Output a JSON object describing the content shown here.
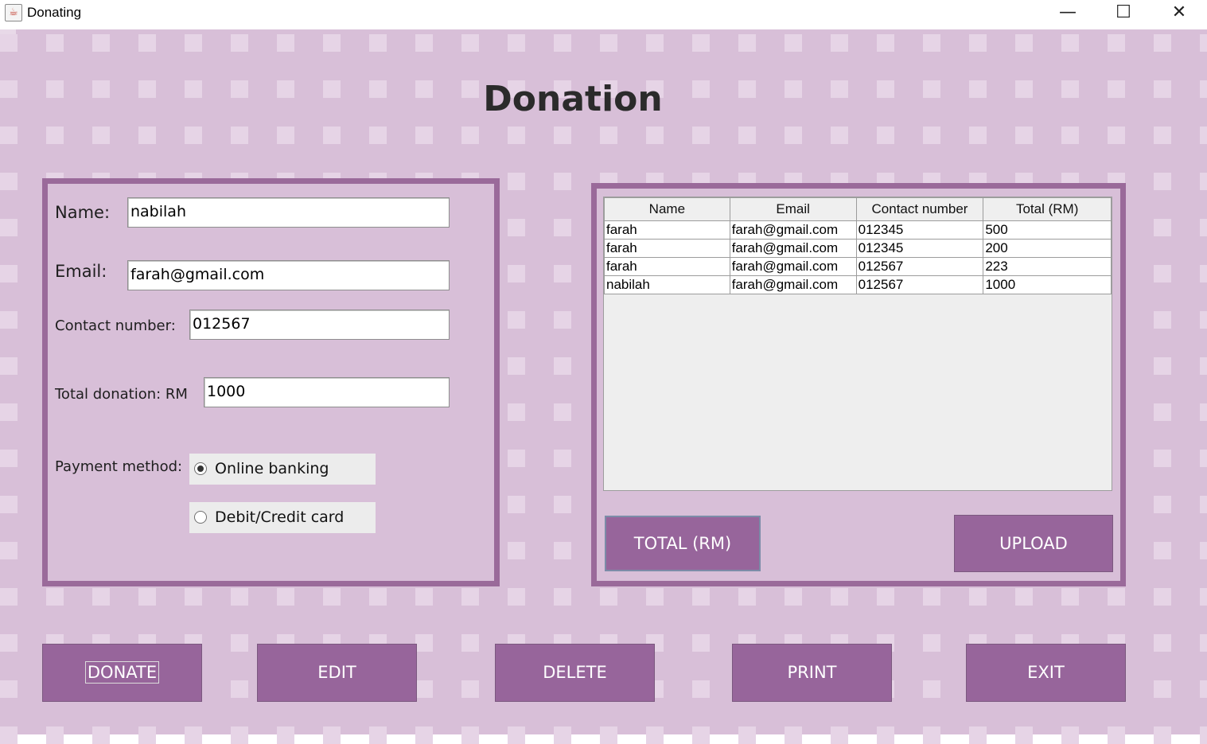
{
  "window": {
    "title": "Donating",
    "minimize": "—",
    "maximize": "☐",
    "close": "✕"
  },
  "heading": "Donation",
  "form": {
    "name_label": "Name:",
    "name_value": "nabilah",
    "email_label": "Email:",
    "email_value": "farah@gmail.com",
    "contact_label": "Contact number:",
    "contact_value": "012567",
    "total_label": "Total donation: RM",
    "total_value": "1000",
    "payment_label": "Payment method:",
    "payment_options": [
      "Online banking",
      "Debit/Credit card"
    ],
    "payment_selected": "Online banking"
  },
  "table": {
    "columns": [
      "Name",
      "Email",
      "Contact number",
      "Total (RM)"
    ],
    "rows": [
      [
        "farah",
        "farah@gmail.com",
        "012345",
        "500"
      ],
      [
        "farah",
        "farah@gmail.com",
        "012345",
        "200"
      ],
      [
        "farah",
        "farah@gmail.com",
        "012567",
        "223"
      ],
      [
        "nabilah",
        "farah@gmail.com",
        "012567",
        "1000"
      ]
    ]
  },
  "panel_buttons": {
    "total": "TOTAL (RM)",
    "upload": "UPLOAD"
  },
  "actions": {
    "donate": "DONATE",
    "edit": "EDIT",
    "delete": "DELETE",
    "print": "PRINT",
    "exit": "EXIT"
  },
  "colors": {
    "background": "#d8bfd8",
    "panel_border": "#9a6a9a",
    "button": "#97659b",
    "tile": "#e6d4e6"
  }
}
